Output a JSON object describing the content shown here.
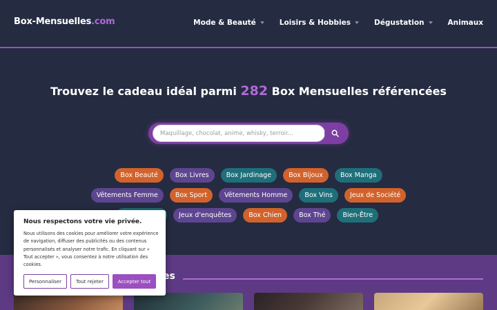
{
  "header": {
    "logo_main": "Box-Mensuelles",
    "logo_ext": ".com",
    "nav": [
      {
        "label": "Mode & Beauté"
      },
      {
        "label": "Loisirs & Hobbies"
      },
      {
        "label": "Dégustation"
      },
      {
        "label": "Animaux"
      }
    ]
  },
  "hero": {
    "title_before": "Trouvez le cadeau idéal parmi ",
    "count": "282",
    "title_after": " Box Mensuelles référencées",
    "search_placeholder": "Maquillage, chocolat, anime, whisky, terroir..."
  },
  "tags": {
    "row1": [
      "Box Beauté",
      "Box Livres",
      "Box Jardinage",
      "Box Bijoux",
      "Box Manga"
    ],
    "row2": [
      "Vêtements Femme",
      "Box Sport",
      "Vêtements Homme",
      "Box Vins",
      "Jeux de Société"
    ],
    "row3": [
      "Jeux d'enquêtes",
      "Box Chien",
      "Box Thé",
      "Bien-Être"
    ]
  },
  "section": {
    "title_partial": "es"
  },
  "cookie": {
    "title": "Nous respectons votre vie privée.",
    "text": "Nous utilisons des cookies pour améliorer votre expérience de navigation, diffuser des publicités ou des contenus personnalisés et analyser notre trafic. En cliquant sur « Tout accepter », vous consentez à notre utilisation des cookies.",
    "btn_customize": "Personnaliser",
    "btn_reject": "Tout rejeter",
    "btn_accept": "Accepter tout"
  },
  "colors": {
    "background": "#252b41",
    "accent": "#b06ad9",
    "tag_orange": "#d2622b",
    "tag_purple": "#5e4590",
    "tag_teal": "#1e6f7a"
  }
}
